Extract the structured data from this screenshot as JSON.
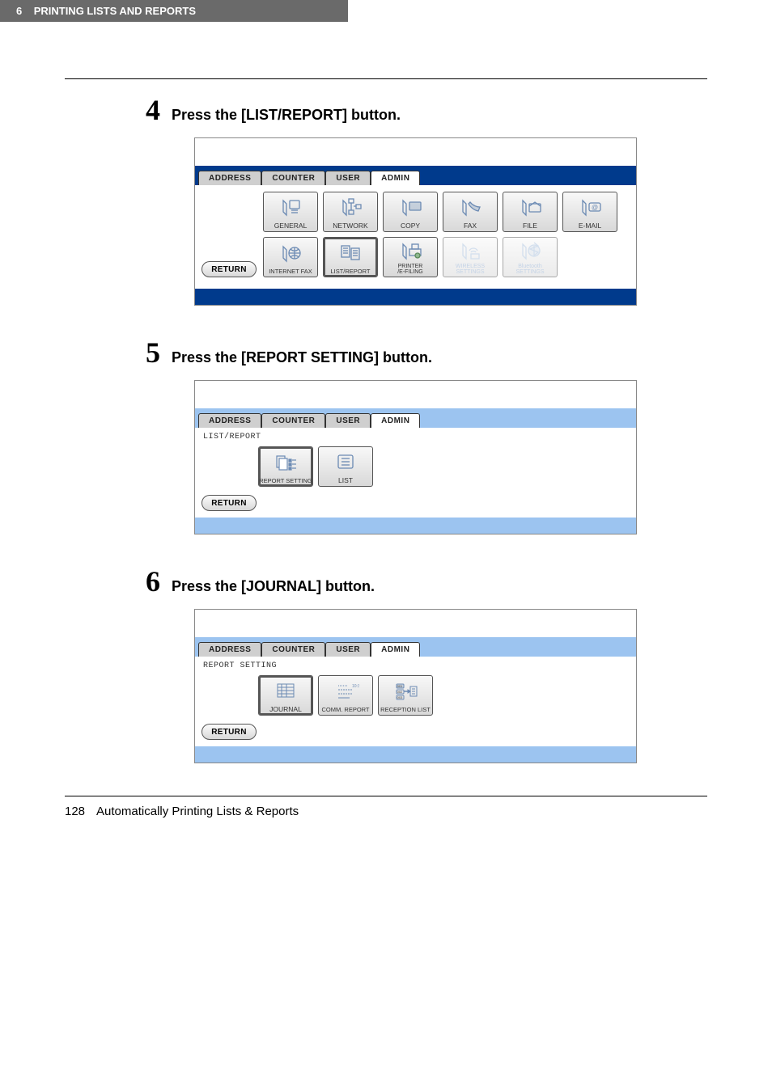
{
  "header": {
    "chapter_num": "6",
    "chapter_title": "PRINTING LISTS AND REPORTS"
  },
  "steps": [
    {
      "num": "4",
      "text": "Press the [LIST/REPORT] button."
    },
    {
      "num": "5",
      "text": "Press the [REPORT SETTING] button."
    },
    {
      "num": "6",
      "text": "Press the [JOURNAL] button."
    }
  ],
  "tabs": {
    "address": "ADDRESS",
    "counter": "COUNTER",
    "user": "USER",
    "admin": "ADMIN"
  },
  "screen4": {
    "row1": [
      {
        "name": "general",
        "label": "GENERAL",
        "sel": false,
        "dim": false
      },
      {
        "name": "network",
        "label": "NETWORK",
        "sel": false,
        "dim": false
      },
      {
        "name": "copy",
        "label": "COPY",
        "sel": false,
        "dim": false
      },
      {
        "name": "fax",
        "label": "FAX",
        "sel": false,
        "dim": false
      },
      {
        "name": "file",
        "label": "FILE",
        "sel": false,
        "dim": false
      },
      {
        "name": "email",
        "label": "E-MAIL",
        "sel": false,
        "dim": false
      }
    ],
    "row2": [
      {
        "name": "internet-fax",
        "label": "INTERNET FAX",
        "sel": false,
        "dim": false
      },
      {
        "name": "list-report",
        "label": "LIST/REPORT",
        "sel": true,
        "dim": false
      },
      {
        "name": "printer-efiling",
        "label": "PRINTER\n/E-FILING",
        "sel": false,
        "dim": false
      },
      {
        "name": "wireless-settings",
        "label": "WIRELESS\nSETTINGS",
        "sel": false,
        "dim": true
      },
      {
        "name": "bluetooth-settings",
        "label": "Bluetooth\nSETTINGS",
        "sel": false,
        "dim": true
      }
    ],
    "return": "RETURN"
  },
  "screen5": {
    "breadcrumb": "LIST/REPORT",
    "row1": [
      {
        "name": "report-setting",
        "label": "REPORT SETTING",
        "sel": true
      },
      {
        "name": "list",
        "label": "LIST",
        "sel": false
      }
    ],
    "return": "RETURN"
  },
  "screen6": {
    "breadcrumb": "REPORT SETTING",
    "row1": [
      {
        "name": "journal",
        "label": "JOURNAL",
        "sel": true
      },
      {
        "name": "comm-report",
        "label": "COMM. REPORT",
        "sel": false
      },
      {
        "name": "reception-list",
        "label": "RECEPTION LIST",
        "sel": false
      }
    ],
    "return": "RETURN"
  },
  "footer": {
    "page": "128",
    "title": "Automatically Printing Lists & Reports"
  }
}
